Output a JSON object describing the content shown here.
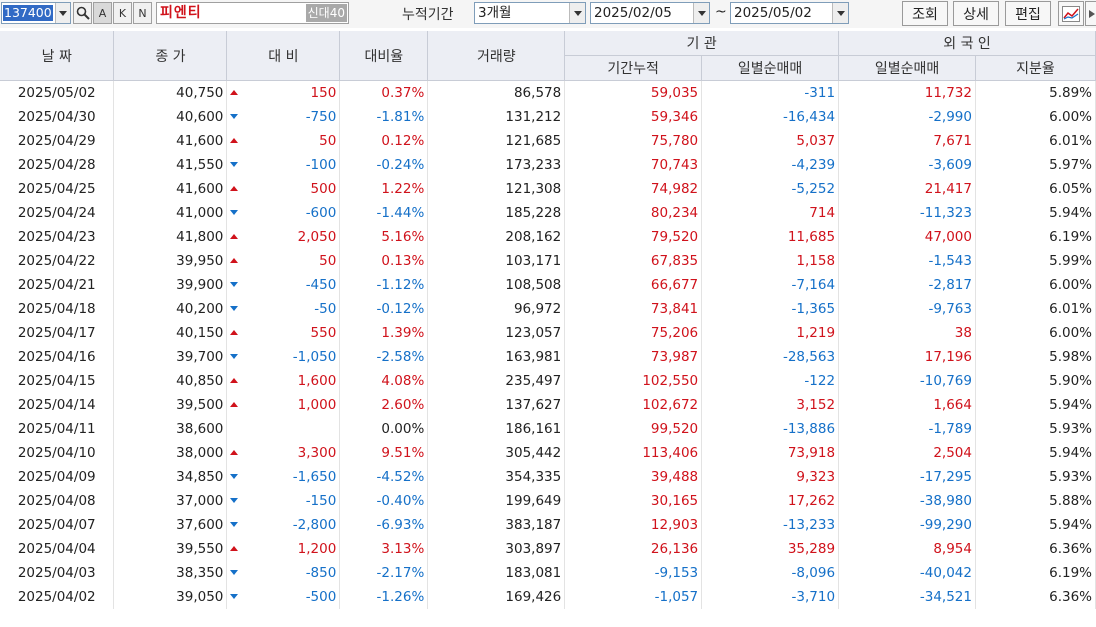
{
  "toolbar": {
    "code": "137400",
    "btn_a": "A",
    "btn_k": "K",
    "btn_n": "N",
    "stock_name": "피엔티",
    "name_badge": "신대40",
    "period_label": "누적기간",
    "period_value": "3개월",
    "start_date": "2025/02/05",
    "tilde": "~",
    "end_date": "2025/05/02",
    "query_button": "조회",
    "detail_button": "상세",
    "edit_button": "편집"
  },
  "headers": {
    "date": "날 짜",
    "close": "종 가",
    "change": "대 비",
    "change_rate": "대비율",
    "volume": "거래량",
    "institution": "기 관",
    "inst_cumulative": "기간누적",
    "inst_daily": "일별순매매",
    "foreign": "외 국 인",
    "foreign_daily": "일별순매매",
    "foreign_share": "지분율"
  },
  "colors": {
    "up": "#d0121b",
    "down": "#1570c8",
    "header_bg": "#eceef4"
  },
  "rows": [
    {
      "date": "2025/05/02",
      "close": "40,750",
      "dir": "up",
      "change": "150",
      "rate": "0.37%",
      "volume": "86,578",
      "inst_cum": "59,035",
      "inst_daily": "-311",
      "for_daily": "11,732",
      "share": "5.89%"
    },
    {
      "date": "2025/04/30",
      "close": "40,600",
      "dir": "down",
      "change": "-750",
      "rate": "-1.81%",
      "volume": "131,212",
      "inst_cum": "59,346",
      "inst_daily": "-16,434",
      "for_daily": "-2,990",
      "share": "6.00%"
    },
    {
      "date": "2025/04/29",
      "close": "41,600",
      "dir": "up",
      "change": "50",
      "rate": "0.12%",
      "volume": "121,685",
      "inst_cum": "75,780",
      "inst_daily": "5,037",
      "for_daily": "7,671",
      "share": "6.01%"
    },
    {
      "date": "2025/04/28",
      "close": "41,550",
      "dir": "down",
      "change": "-100",
      "rate": "-0.24%",
      "volume": "173,233",
      "inst_cum": "70,743",
      "inst_daily": "-4,239",
      "for_daily": "-3,609",
      "share": "5.97%"
    },
    {
      "date": "2025/04/25",
      "close": "41,600",
      "dir": "up",
      "change": "500",
      "rate": "1.22%",
      "volume": "121,308",
      "inst_cum": "74,982",
      "inst_daily": "-5,252",
      "for_daily": "21,417",
      "share": "6.05%"
    },
    {
      "date": "2025/04/24",
      "close": "41,000",
      "dir": "down",
      "change": "-600",
      "rate": "-1.44%",
      "volume": "185,228",
      "inst_cum": "80,234",
      "inst_daily": "714",
      "for_daily": "-11,323",
      "share": "5.94%"
    },
    {
      "date": "2025/04/23",
      "close": "41,800",
      "dir": "up",
      "change": "2,050",
      "rate": "5.16%",
      "volume": "208,162",
      "inst_cum": "79,520",
      "inst_daily": "11,685",
      "for_daily": "47,000",
      "share": "6.19%"
    },
    {
      "date": "2025/04/22",
      "close": "39,950",
      "dir": "up",
      "change": "50",
      "rate": "0.13%",
      "volume": "103,171",
      "inst_cum": "67,835",
      "inst_daily": "1,158",
      "for_daily": "-1,543",
      "share": "5.99%"
    },
    {
      "date": "2025/04/21",
      "close": "39,900",
      "dir": "down",
      "change": "-450",
      "rate": "-1.12%",
      "volume": "108,508",
      "inst_cum": "66,677",
      "inst_daily": "-7,164",
      "for_daily": "-2,817",
      "share": "6.00%"
    },
    {
      "date": "2025/04/18",
      "close": "40,200",
      "dir": "down",
      "change": "-50",
      "rate": "-0.12%",
      "volume": "96,972",
      "inst_cum": "73,841",
      "inst_daily": "-1,365",
      "for_daily": "-9,763",
      "share": "6.01%"
    },
    {
      "date": "2025/04/17",
      "close": "40,150",
      "dir": "up",
      "change": "550",
      "rate": "1.39%",
      "volume": "123,057",
      "inst_cum": "75,206",
      "inst_daily": "1,219",
      "for_daily": "38",
      "share": "6.00%"
    },
    {
      "date": "2025/04/16",
      "close": "39,700",
      "dir": "down",
      "change": "-1,050",
      "rate": "-2.58%",
      "volume": "163,981",
      "inst_cum": "73,987",
      "inst_daily": "-28,563",
      "for_daily": "17,196",
      "share": "5.98%"
    },
    {
      "date": "2025/04/15",
      "close": "40,850",
      "dir": "up",
      "change": "1,600",
      "rate": "4.08%",
      "volume": "235,497",
      "inst_cum": "102,550",
      "inst_daily": "-122",
      "for_daily": "-10,769",
      "share": "5.90%"
    },
    {
      "date": "2025/04/14",
      "close": "39,500",
      "dir": "up",
      "change": "1,000",
      "rate": "2.60%",
      "volume": "137,627",
      "inst_cum": "102,672",
      "inst_daily": "3,152",
      "for_daily": "1,664",
      "share": "5.94%"
    },
    {
      "date": "2025/04/11",
      "close": "38,600",
      "dir": "flat",
      "change": "",
      "rate": "0.00%",
      "volume": "186,161",
      "inst_cum": "99,520",
      "inst_daily": "-13,886",
      "for_daily": "-1,789",
      "share": "5.93%"
    },
    {
      "date": "2025/04/10",
      "close": "38,000",
      "dir": "up",
      "change": "3,300",
      "rate": "9.51%",
      "volume": "305,442",
      "inst_cum": "113,406",
      "inst_daily": "73,918",
      "for_daily": "2,504",
      "share": "5.94%"
    },
    {
      "date": "2025/04/09",
      "close": "34,850",
      "dir": "down",
      "change": "-1,650",
      "rate": "-4.52%",
      "volume": "354,335",
      "inst_cum": "39,488",
      "inst_daily": "9,323",
      "for_daily": "-17,295",
      "share": "5.93%"
    },
    {
      "date": "2025/04/08",
      "close": "37,000",
      "dir": "down",
      "change": "-150",
      "rate": "-0.40%",
      "volume": "199,649",
      "inst_cum": "30,165",
      "inst_daily": "17,262",
      "for_daily": "-38,980",
      "share": "5.88%"
    },
    {
      "date": "2025/04/07",
      "close": "37,600",
      "dir": "down",
      "change": "-2,800",
      "rate": "-6.93%",
      "volume": "383,187",
      "inst_cum": "12,903",
      "inst_daily": "-13,233",
      "for_daily": "-99,290",
      "share": "5.94%"
    },
    {
      "date": "2025/04/04",
      "close": "39,550",
      "dir": "up",
      "change": "1,200",
      "rate": "3.13%",
      "volume": "303,897",
      "inst_cum": "26,136",
      "inst_daily": "35,289",
      "for_daily": "8,954",
      "share": "6.36%"
    },
    {
      "date": "2025/04/03",
      "close": "38,350",
      "dir": "down",
      "change": "-850",
      "rate": "-2.17%",
      "volume": "183,081",
      "inst_cum": "-9,153",
      "inst_daily": "-8,096",
      "for_daily": "-40,042",
      "share": "6.19%"
    },
    {
      "date": "2025/04/02",
      "close": "39,050",
      "dir": "down",
      "change": "-500",
      "rate": "-1.26%",
      "volume": "169,426",
      "inst_cum": "-1,057",
      "inst_daily": "-3,710",
      "for_daily": "-34,521",
      "share": "6.36%"
    }
  ]
}
